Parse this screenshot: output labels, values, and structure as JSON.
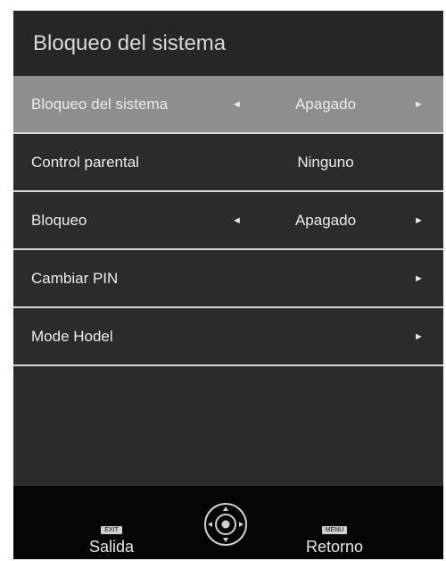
{
  "header": {
    "title": "Bloqueo del sistema"
  },
  "menu": {
    "items": [
      {
        "label": "Bloqueo del sistema",
        "left_arrow": "◄",
        "value": "Apagado",
        "right_arrow": "►",
        "selected": true
      },
      {
        "label": "Control parental",
        "left_arrow": "",
        "value": "Ninguno",
        "right_arrow": "",
        "selected": false
      },
      {
        "label": "Bloqueo",
        "left_arrow": "◄",
        "value": "Apagado",
        "right_arrow": "►",
        "selected": false
      },
      {
        "label": "Cambiar PIN",
        "left_arrow": "",
        "value": "",
        "right_arrow": "►",
        "selected": false
      },
      {
        "label": "Mode Hodel",
        "left_arrow": "",
        "value": "",
        "right_arrow": "►",
        "selected": false
      }
    ]
  },
  "footer": {
    "exit_key": "EXIT",
    "exit_label": "Salida",
    "menu_key": "MENU",
    "menu_label": "Retorno",
    "nav_icon": "dpad-icon"
  },
  "colors": {
    "background": "#2b2b2b",
    "header": "#262626",
    "selected_row": "#8e8e8e",
    "divider": "#d8d8d8",
    "footer": "#050505",
    "text": "#ececec"
  }
}
